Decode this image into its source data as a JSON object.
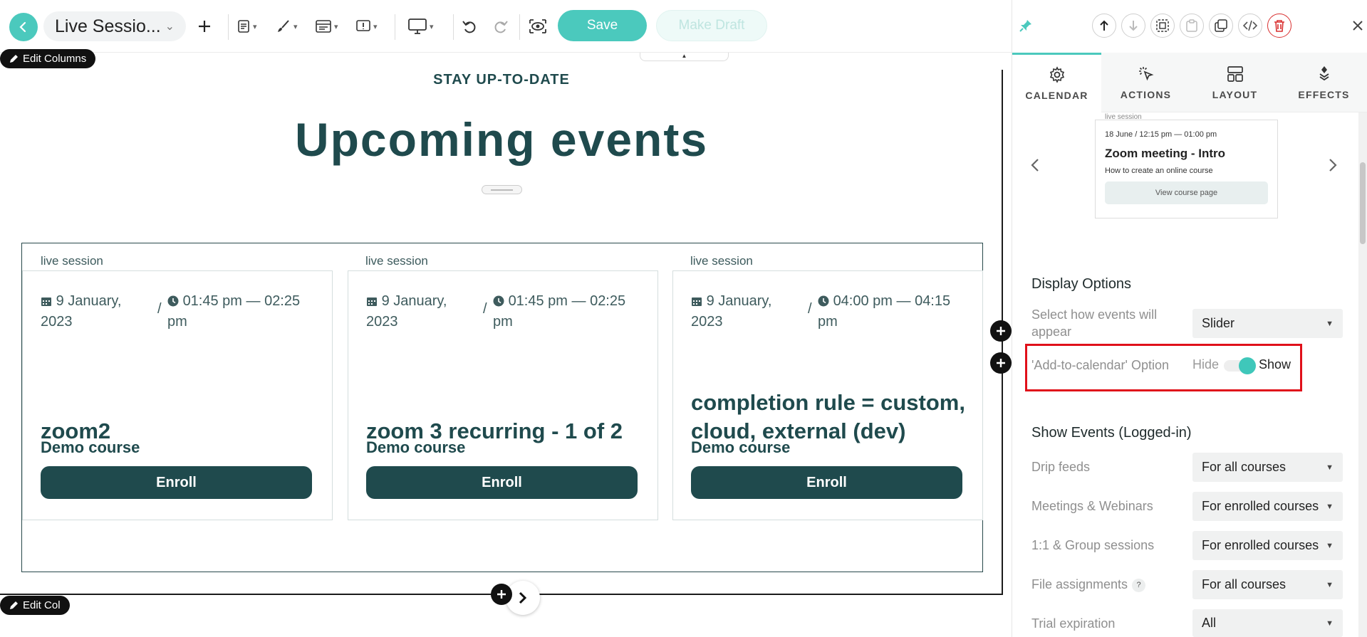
{
  "toolbar": {
    "page_title": "Live Sessio...",
    "save_label": "Save",
    "draft_label": "Make Draft"
  },
  "canvas": {
    "edit_columns_label": "Edit Columns",
    "edit_col_label": "Edit Col",
    "eyebrow": "STAY UP-TO-DATE",
    "heading": "Upcoming events",
    "events": [
      {
        "tag": "live session",
        "date": "9 January, 2023",
        "time": "01:45 pm — 02:25 pm",
        "title": "zoom2",
        "course": "Demo course",
        "button": "Enroll"
      },
      {
        "tag": "live session",
        "date": "9 January, 2023",
        "time": "01:45 pm — 02:25 pm",
        "title": "zoom 3 recurring - 1 of 2",
        "course": "Demo course",
        "button": "Enroll"
      },
      {
        "tag": "live session",
        "date": "9 January, 2023",
        "time": "04:00 pm — 04:15 pm",
        "title": "completion rule = custom, cloud, external (dev)",
        "course": "Demo course",
        "button": "Enroll"
      }
    ]
  },
  "panel": {
    "tabs": [
      {
        "label": "CALENDAR",
        "icon": "gear-icon",
        "active": true
      },
      {
        "label": "ACTIONS",
        "icon": "cursor-click-icon",
        "active": false
      },
      {
        "label": "LAYOUT",
        "icon": "layout-icon",
        "active": false
      },
      {
        "label": "EFFECTS",
        "icon": "effects-icon",
        "active": false
      }
    ],
    "preview": {
      "label": "live session",
      "meta": "18 June / 12:15 pm — 01:00 pm",
      "title": "Zoom meeting - Intro",
      "subtitle": "How to create an online course",
      "link": "View course page"
    },
    "display_options": {
      "heading": "Display Options",
      "appear_label": "Select how events will appear",
      "appear_value": "Slider",
      "calendar_label": "'Add-to-calendar' Option",
      "toggle_off": "Hide",
      "toggle_on": "Show",
      "toggle_state": "Show"
    },
    "show_events": {
      "heading": "Show Events (Logged-in)",
      "rows": [
        {
          "label": "Drip feeds",
          "value": "For all courses"
        },
        {
          "label": "Meetings & Webinars",
          "value": "For enrolled courses"
        },
        {
          "label": "1:1 & Group sessions",
          "value": "For enrolled courses"
        },
        {
          "label": "File assignments",
          "value": "For all courses",
          "help": "?"
        },
        {
          "label": "Trial expiration",
          "value": "All"
        }
      ]
    }
  },
  "colors": {
    "accent": "#4bc9bd",
    "brand_dark": "#1f4a4d",
    "highlight": "#e0101a",
    "danger": "#d93030"
  }
}
